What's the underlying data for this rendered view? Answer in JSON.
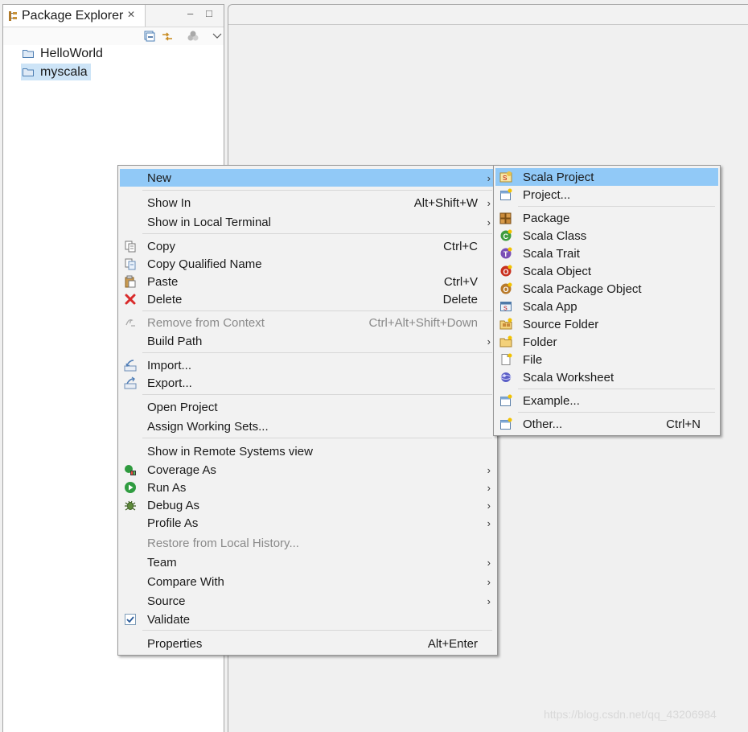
{
  "view": {
    "title": "Package Explorer",
    "close_glyph": "✕",
    "minimize_glyph": "–",
    "maximize_glyph": "□",
    "tree": [
      "HelloWorld",
      "myscala"
    ]
  },
  "context_menu": {
    "items": [
      {
        "label": "New",
        "accel": "",
        "submenu": true,
        "icon": ""
      },
      {
        "label": "Show In",
        "accel": "Alt+Shift+W",
        "submenu": true,
        "icon": ""
      },
      {
        "label": "Show in Local Terminal",
        "accel": "",
        "submenu": true,
        "icon": ""
      },
      {
        "label": "Copy",
        "accel": "Ctrl+C",
        "submenu": false,
        "icon": "copy-icon"
      },
      {
        "label": "Copy Qualified Name",
        "accel": "",
        "submenu": false,
        "icon": "copy-qualified-name-icon"
      },
      {
        "label": "Paste",
        "accel": "Ctrl+V",
        "submenu": false,
        "icon": "paste-icon"
      },
      {
        "label": "Delete",
        "accel": "Delete",
        "submenu": false,
        "icon": "delete-icon"
      },
      {
        "label": "Remove from Context",
        "accel": "Ctrl+Alt+Shift+Down",
        "submenu": false,
        "icon": "remove-context-icon"
      },
      {
        "label": "Build Path",
        "accel": "",
        "submenu": true,
        "icon": ""
      },
      {
        "label": "Import...",
        "accel": "",
        "submenu": false,
        "icon": "import-icon"
      },
      {
        "label": "Export...",
        "accel": "",
        "submenu": false,
        "icon": "export-icon"
      },
      {
        "label": "Open Project",
        "accel": "",
        "submenu": false,
        "icon": ""
      },
      {
        "label": "Assign Working Sets...",
        "accel": "",
        "submenu": false,
        "icon": ""
      },
      {
        "label": "Show in Remote Systems view",
        "accel": "",
        "submenu": false,
        "icon": ""
      },
      {
        "label": "Coverage As",
        "accel": "",
        "submenu": true,
        "icon": "coverage-icon"
      },
      {
        "label": "Run As",
        "accel": "",
        "submenu": true,
        "icon": "run-icon"
      },
      {
        "label": "Debug As",
        "accel": "",
        "submenu": true,
        "icon": "debug-bug-icon"
      },
      {
        "label": "Profile As",
        "accel": "",
        "submenu": true,
        "icon": ""
      },
      {
        "label": "Restore from Local History...",
        "accel": "",
        "submenu": false,
        "icon": ""
      },
      {
        "label": "Team",
        "accel": "",
        "submenu": true,
        "icon": ""
      },
      {
        "label": "Compare With",
        "accel": "",
        "submenu": true,
        "icon": ""
      },
      {
        "label": "Source",
        "accel": "",
        "submenu": true,
        "icon": ""
      },
      {
        "label": "Validate",
        "accel": "",
        "submenu": false,
        "icon": "validate-checkbox-icon"
      },
      {
        "label": "Properties",
        "accel": "Alt+Enter",
        "submenu": false,
        "icon": ""
      }
    ]
  },
  "new_submenu": {
    "items": [
      {
        "label": "Scala Project",
        "accel": "",
        "icon": "scala-project-icon"
      },
      {
        "label": "Project...",
        "accel": "",
        "icon": "project-wizard-icon"
      },
      {
        "label": "Package",
        "accel": "",
        "icon": "package-icon"
      },
      {
        "label": "Scala Class",
        "accel": "",
        "icon": "scala-class-icon"
      },
      {
        "label": "Scala Trait",
        "accel": "",
        "icon": "scala-trait-icon"
      },
      {
        "label": "Scala Object",
        "accel": "",
        "icon": "scala-object-icon"
      },
      {
        "label": "Scala Package Object",
        "accel": "",
        "icon": "scala-package-object-icon"
      },
      {
        "label": "Scala App",
        "accel": "",
        "icon": "scala-app-icon"
      },
      {
        "label": "Source Folder",
        "accel": "",
        "icon": "source-folder-icon"
      },
      {
        "label": "Folder",
        "accel": "",
        "icon": "folder-icon"
      },
      {
        "label": "File",
        "accel": "",
        "icon": "file-icon"
      },
      {
        "label": "Scala Worksheet",
        "accel": "",
        "icon": "scala-worksheet-icon"
      },
      {
        "label": "Example...",
        "accel": "",
        "icon": "example-wizard-icon"
      },
      {
        "label": "Other...",
        "accel": "Ctrl+N",
        "icon": "other-wizard-icon"
      }
    ]
  },
  "watermark": "https://blog.csdn.net/qq_43206984",
  "colors": {
    "highlight": "#91c9f7",
    "selection": "#cde4f7",
    "menu_bg": "#f2f2f2"
  }
}
